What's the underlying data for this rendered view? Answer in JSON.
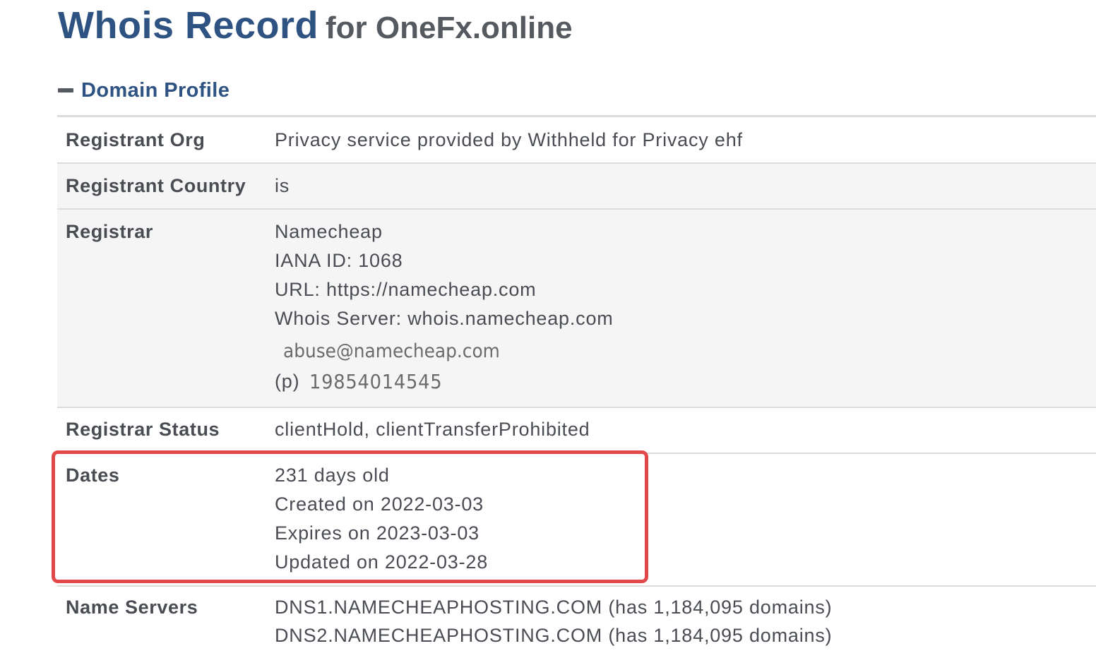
{
  "title": {
    "main": "Whois Record",
    "sub": "for OneFx.online"
  },
  "section": {
    "label": "Domain Profile",
    "toggle_icon": "minus-icon"
  },
  "profile": {
    "registrant_org": {
      "key": "Registrant Org",
      "value": "Privacy service provided by Withheld for Privacy ehf"
    },
    "registrant_country": {
      "key": "Registrant Country",
      "value": "is"
    },
    "registrar": {
      "key": "Registrar",
      "name": "Namecheap",
      "iana": "IANA ID: 1068",
      "url": "URL: https://namecheap.com",
      "whois_server": "Whois Server: whois.namecheap.com",
      "email": "abuse@namecheap.com",
      "phone_label": "(p)",
      "phone": "19854014545"
    },
    "registrar_status": {
      "key": "Registrar Status",
      "value": "clientHold, clientTransferProhibited"
    },
    "dates": {
      "key": "Dates",
      "age": "231 days old",
      "created": "Created on 2022-03-03",
      "expires": "Expires on 2023-03-03",
      "updated": "Updated on 2022-03-28"
    },
    "name_servers": {
      "key": "Name Servers",
      "ns1": "DNS1.NAMECHEAPHOSTING.COM (has 1,184,095 domains)",
      "ns2": "DNS2.NAMECHEAPHOSTING.COM (has 1,184,095 domains)"
    }
  },
  "highlight_color": "#e0484a",
  "colors": {
    "heading_blue": "#2e5382",
    "text_gray": "#494c52",
    "row_shade": "#f5f5f5",
    "divider": "#dcdcdc"
  }
}
